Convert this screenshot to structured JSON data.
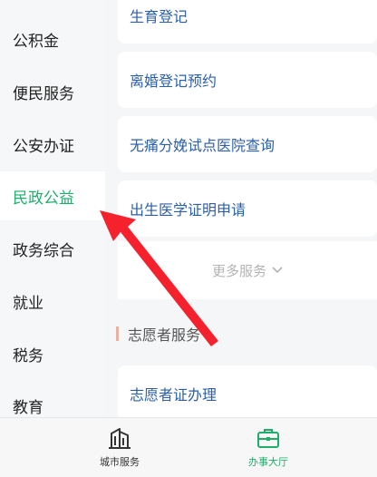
{
  "sidebar": {
    "items": [
      {
        "label": "公积金"
      },
      {
        "label": "便民服务"
      },
      {
        "label": "公安办证"
      },
      {
        "label": "民政公益",
        "active": true
      },
      {
        "label": "政务综合"
      },
      {
        "label": "就业"
      },
      {
        "label": "税务"
      },
      {
        "label": "教育"
      }
    ]
  },
  "services": {
    "items": [
      {
        "label": "生育登记"
      },
      {
        "label": "离婚登记预约"
      },
      {
        "label": "无痛分娩试点医院查询"
      },
      {
        "label": "出生医学证明申请"
      }
    ],
    "more_label": "更多服务"
  },
  "volunteer": {
    "section_title": "志愿者服务",
    "items": [
      {
        "label": "志愿者证办理"
      }
    ]
  },
  "bottom_nav": {
    "tabs": [
      {
        "label": "城市服务",
        "icon": "city-building-icon"
      },
      {
        "label": "办事大厅",
        "icon": "briefcase-icon",
        "active": true
      }
    ]
  },
  "colors": {
    "accent": "#1fad6a",
    "link": "#2b5fa8",
    "annotation_arrow": "#f5212d"
  }
}
